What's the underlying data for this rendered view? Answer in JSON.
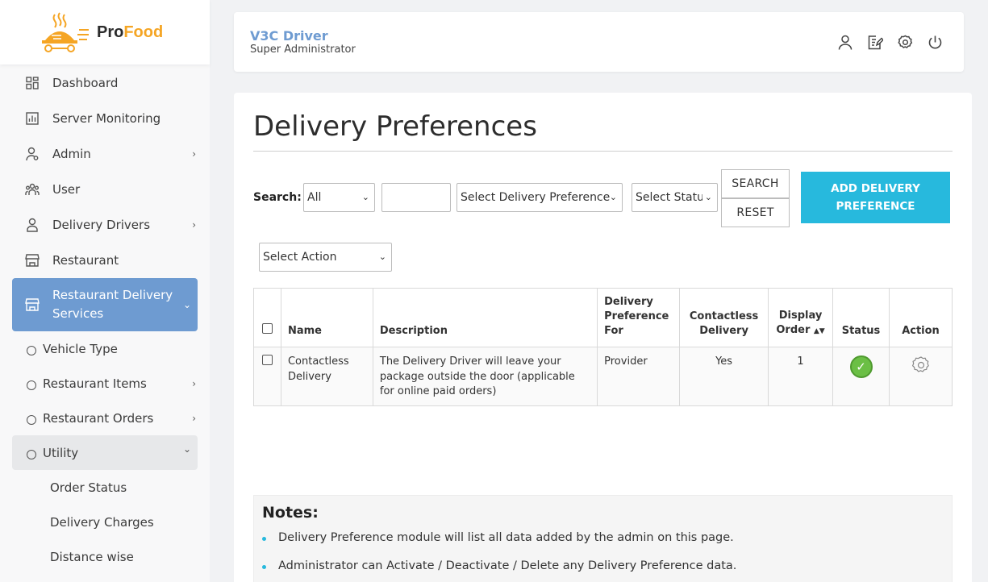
{
  "app": {
    "logo_pro": "Pro",
    "logo_food": "Food"
  },
  "sidebar": {
    "items": [
      {
        "label": "Dashboard",
        "icon": "dashboard-icon"
      },
      {
        "label": "Server Monitoring",
        "icon": "chart-icon"
      },
      {
        "label": "Admin",
        "icon": "admin-icon",
        "has_children": true
      },
      {
        "label": "User",
        "icon": "users-icon"
      },
      {
        "label": "Delivery Drivers",
        "icon": "driver-icon",
        "has_children": true
      },
      {
        "label": "Restaurant",
        "icon": "store-icon"
      },
      {
        "label": "Restaurant Delivery Services",
        "icon": "store-icon",
        "active": true,
        "expanded": true
      }
    ],
    "sub_items": [
      {
        "label": "Vehicle Type"
      },
      {
        "label": "Restaurant Items",
        "has_children": true
      },
      {
        "label": "Restaurant Orders",
        "has_children": true
      },
      {
        "label": "Utility",
        "expanded": true
      }
    ],
    "utility_items": [
      {
        "label": "Order Status"
      },
      {
        "label": "Delivery Charges"
      },
      {
        "label": "Distance wise"
      }
    ]
  },
  "header": {
    "user_name": "V3C Driver",
    "user_role": "Super Administrator",
    "icons": [
      "profile-icon",
      "edit-icon",
      "settings-icon",
      "power-icon"
    ]
  },
  "main": {
    "title": "Delivery Preferences",
    "search_label": "Search:",
    "filter_all": "All",
    "search_input_value": "",
    "select_preference": "Select Delivery Preference",
    "select_status": "Select Status",
    "search_button": "SEARCH",
    "reset_button": "RESET",
    "add_button": "ADD DELIVERY PREFERENCE",
    "select_action": "Select Action"
  },
  "table": {
    "headers": {
      "name": "Name",
      "description": "Description",
      "pref_for": "Delivery Preference For",
      "contactless": "Contactless Delivery",
      "display_order": "Display Order",
      "status": "Status",
      "action": "Action"
    },
    "rows": [
      {
        "name": "Contactless Delivery",
        "description": "The Delivery Driver will leave your package outside the door (applicable for online paid orders)",
        "pref_for": "Provider",
        "contactless": "Yes",
        "display_order": "1",
        "status": "active"
      }
    ]
  },
  "notes": {
    "title": "Notes:",
    "items": [
      "Delivery Preference module will list all data added by the admin on this page.",
      "Administrator can Activate / Deactivate / Delete any Delivery Preference data."
    ]
  },
  "colors": {
    "accent_blue": "#6e9bd1",
    "button_cyan": "#27b9dd",
    "logo_orange": "#f5a524",
    "status_green": "#6bbf45"
  }
}
